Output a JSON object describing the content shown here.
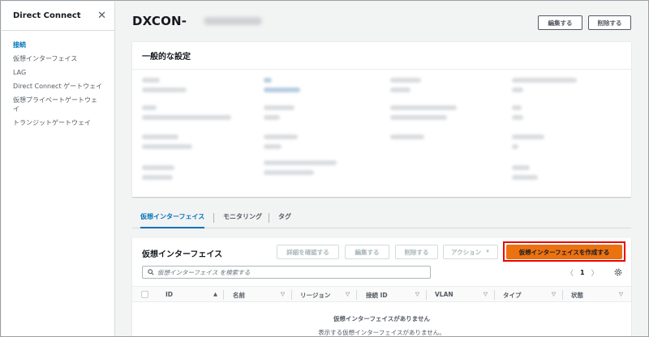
{
  "sidebar": {
    "title": "Direct Connect",
    "close_glyph": "✕",
    "items": [
      {
        "label": "接続",
        "active": true
      },
      {
        "label": "仮想インターフェイス"
      },
      {
        "label": "LAG"
      },
      {
        "label": "Direct Connect ゲートウェイ"
      },
      {
        "label": "仮想プライベートゲートウェ"
      },
      {
        "label": "イ"
      },
      {
        "label": "トランジットゲートウェイ"
      }
    ]
  },
  "header": {
    "title": "DXCON-",
    "edit_label": "編集する",
    "delete_label": "削除する"
  },
  "general": {
    "title": "一般的な設定"
  },
  "tabs": [
    {
      "label": "仮想インターフェイス",
      "active": true
    },
    {
      "label": "モニタリング"
    },
    {
      "label": "タグ"
    }
  ],
  "vif": {
    "title": "仮想インターフェイス",
    "buttons": {
      "details": "詳細を確認する",
      "edit": "編集する",
      "delete": "削除する",
      "actions": "アクション",
      "actions_caret": "▼",
      "create": "仮想インターフェイスを作成する"
    },
    "search_placeholder": "仮想インターフェイス を検索する",
    "pagination": {
      "prev": "〈",
      "page": "1",
      "next": "〉"
    },
    "columns": [
      {
        "label": "ID",
        "sort": "▲"
      },
      {
        "label": "名前",
        "sort": "▽"
      },
      {
        "label": "リージョン",
        "sort": "▽"
      },
      {
        "label": "接続 ID",
        "sort": "▽"
      },
      {
        "label": "VLAN",
        "sort": "▽"
      },
      {
        "label": "タイプ",
        "sort": "▽"
      },
      {
        "label": "状態",
        "sort": "▽"
      }
    ],
    "empty_title": "仮想インターフェイスがありません",
    "empty_subtitle": "表示する仮想インターフェイスがありません。"
  },
  "colors": {
    "accent": "#0073bb",
    "primary_button": "#ec7211",
    "highlight_outline": "#ee0000"
  },
  "icons": {
    "search": "search-icon",
    "settings": "gear-icon",
    "close": "close-icon"
  }
}
